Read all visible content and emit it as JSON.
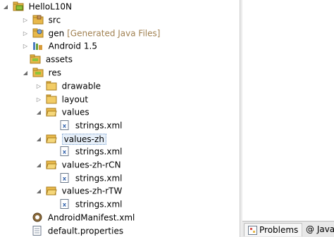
{
  "tree": {
    "project": {
      "label": "HelloL10N",
      "twisty": "◢"
    },
    "src": {
      "label": "src",
      "twisty": "▷"
    },
    "gen": {
      "label": "gen",
      "decoration": "[Generated Java Files]",
      "twisty": "▷"
    },
    "android": {
      "label": "Android 1.5",
      "twisty": "▷"
    },
    "assets": {
      "label": "assets"
    },
    "res": {
      "label": "res",
      "twisty": "◢"
    },
    "drawable": {
      "label": "drawable",
      "twisty": "▷"
    },
    "layout": {
      "label": "layout",
      "twisty": "▷"
    },
    "values": {
      "label": "values",
      "twisty": "◢"
    },
    "values_strings": {
      "label": "strings.xml"
    },
    "values_zh": {
      "label": "values-zh",
      "twisty": "◢"
    },
    "values_zh_strings": {
      "label": "strings.xml"
    },
    "values_zh_rCN": {
      "label": "values-zh-rCN",
      "twisty": "◢"
    },
    "values_zh_rCN_strings": {
      "label": "strings.xml"
    },
    "values_zh_rTW": {
      "label": "values-zh-rTW",
      "twisty": "◢"
    },
    "values_zh_rTW_strings": {
      "label": "strings.xml"
    },
    "manifest": {
      "label": "AndroidManifest.xml"
    },
    "default_properties": {
      "label": "default.properties"
    }
  },
  "bottom_tabs": {
    "problems": "Problems",
    "javadoc": "@ Javac"
  },
  "colors": {
    "folder": "#e8b84a",
    "selection": "#e6eff9",
    "decoration": "#a08050"
  }
}
